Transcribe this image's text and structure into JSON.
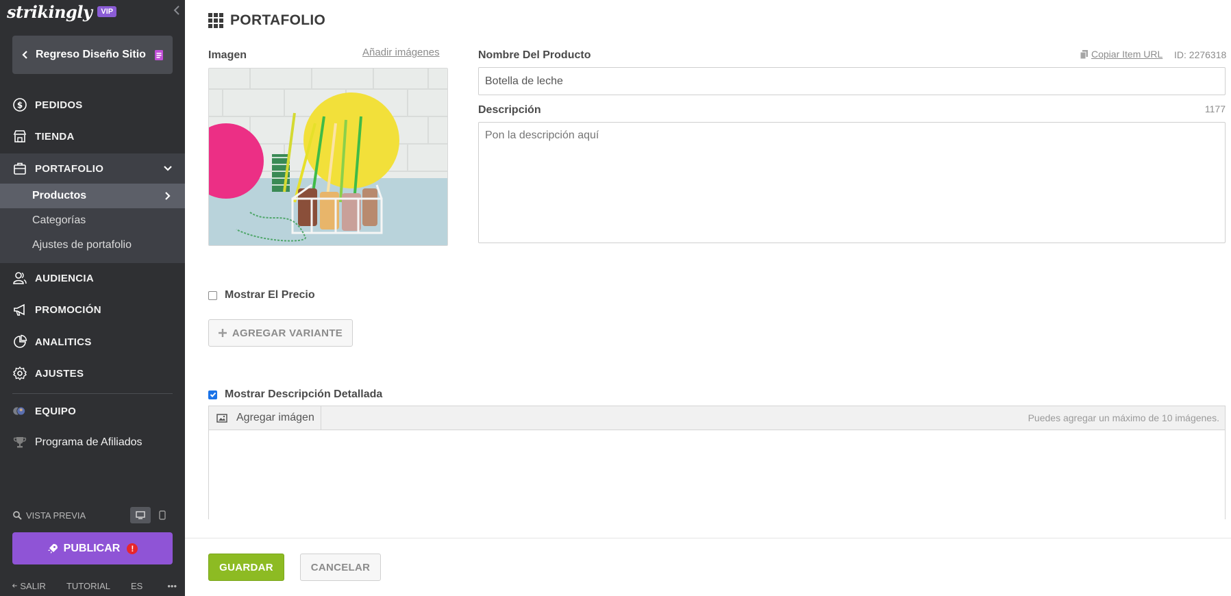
{
  "sidebar": {
    "logo": "strikingly",
    "badge": "VIP",
    "back_label": "Regreso Diseño Sitio",
    "items": [
      {
        "label": "PEDIDOS",
        "icon": "dollar-circle-icon"
      },
      {
        "label": "TIENDA",
        "icon": "store-icon"
      },
      {
        "label": "PORTAFOLIO",
        "icon": "briefcase-icon"
      },
      {
        "label": "AUDIENCIA",
        "icon": "audience-icon"
      },
      {
        "label": "PROMOCIÓN",
        "icon": "megaphone-icon"
      },
      {
        "label": "ANALITICS",
        "icon": "pie-chart-icon"
      },
      {
        "label": "AJUSTES",
        "icon": "gear-icon"
      },
      {
        "label": "EQUIPO",
        "icon": "team-avatars-icon"
      },
      {
        "label": "Programa de Afiliados",
        "icon": "trophy-icon"
      }
    ],
    "subitems": [
      {
        "label": "Productos"
      },
      {
        "label": "Categorías"
      },
      {
        "label": "Ajustes de portafolio"
      }
    ],
    "preview_label": "VISTA PREVIA",
    "publish_label": "PUBLICAR",
    "publish_alert": "!",
    "footer": {
      "exit": "SALIR",
      "tutorial": "TUTORIAL",
      "lang": "ES",
      "more": "•••"
    }
  },
  "main": {
    "title": "PORTAFOLIO",
    "image_label": "Imagen",
    "add_images": "Añadir imágenes",
    "name_label": "Nombre Del Producto",
    "copy_url": "Copiar Item URL",
    "item_id": "ID: 2276318",
    "name_value": "Botella de leche",
    "desc_label": "Descripción",
    "desc_count": "1177",
    "desc_placeholder": "Pon la descripción aquí",
    "show_price": "Mostrar El Precio",
    "show_price_checked": false,
    "add_variant": "AGREGAR VARIANTE",
    "show_detail": "Mostrar Descripción Detallada",
    "show_detail_checked": true,
    "editor_add_image": "Agregar imágen",
    "editor_hint": "Puedes agregar un máximo de 10 imágenes.",
    "save": "GUARDAR",
    "cancel": "CANCELAR"
  },
  "colors": {
    "sidebar_bg": "#2f3033",
    "accent_purple": "#8f54d6",
    "save_green": "#8dbb23",
    "checkbox_blue": "#1a73e8"
  }
}
